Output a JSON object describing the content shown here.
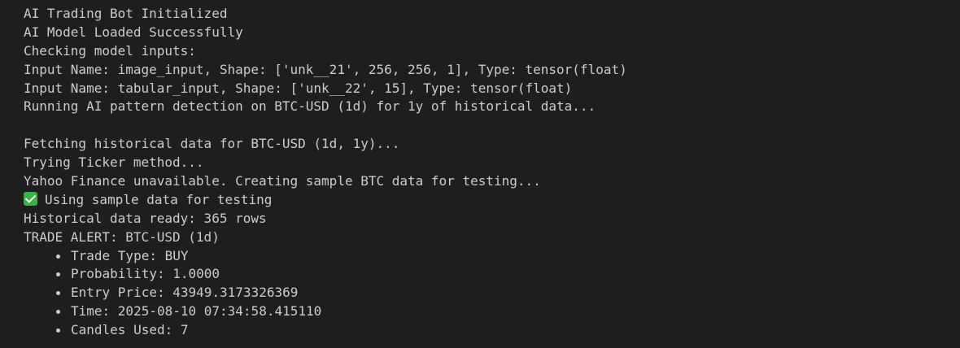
{
  "colors": {
    "background": "#1e1e1e",
    "text": "#cccccc",
    "check_badge": "#3fae46"
  },
  "output": {
    "lines_top": [
      "AI Trading Bot Initialized",
      "AI Model Loaded Successfully",
      "Checking model inputs:",
      "Input Name: image_input, Shape: ['unk__21', 256, 256, 1], Type: tensor(float)",
      "Input Name: tabular_input, Shape: ['unk__22', 15], Type: tensor(float)",
      "Running AI pattern detection on BTC-USD (1d) for 1y of historical data..."
    ],
    "lines_mid": [
      "Fetching historical data for BTC-USD (1d, 1y)...",
      "Trying Ticker method...",
      "Yahoo Finance unavailable. Creating sample BTC data for testing..."
    ],
    "sample_data_line": "Using sample data for testing",
    "check_icon": "check-mark-icon",
    "lines_after": [
      "Historical data ready: 365 rows",
      "TRADE ALERT: BTC-USD (1d)"
    ],
    "trade_details": [
      "Trade Type: BUY",
      "Probability: 1.0000",
      "Entry Price: 43949.3173326369",
      "Time: 2025-08-10 07:34:58.415110",
      "Candles Used: 7"
    ]
  }
}
